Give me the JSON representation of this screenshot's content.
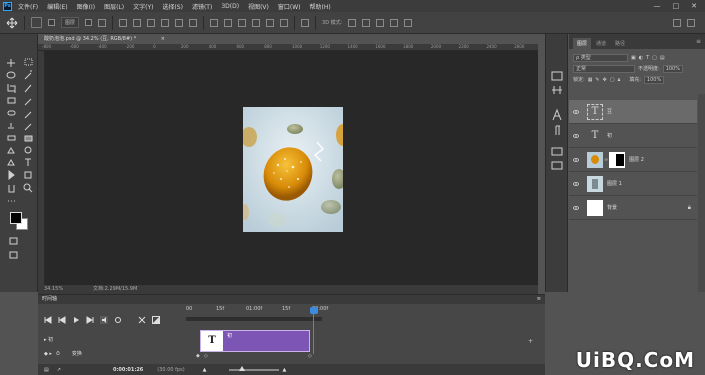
{
  "app": {
    "logo_text": "Ps"
  },
  "menu": [
    "文件(F)",
    "编辑(E)",
    "图像(I)",
    "图层(L)",
    "文字(Y)",
    "选择(S)",
    "滤镜(T)",
    "3D(D)",
    "视图(V)",
    "窗口(W)",
    "帮助(H)"
  ],
  "window_controls": [
    "—",
    "□",
    "✕"
  ],
  "options": {
    "auto_select_value": "图层",
    "mode_3d": "3D 模式:"
  },
  "document": {
    "tab_title": "酸奶泡泡.psd @ 34.2% (豆, RGB/8#) *",
    "zoom": "34.15%",
    "info": "文档:2.29M/15.9M"
  },
  "ruler": {
    "top_marks": [
      "-800",
      "-600",
      "-400",
      "-200",
      "0",
      "200",
      "400",
      "600",
      "800",
      "1000",
      "1200",
      "1400",
      "1600",
      "1800",
      "2000",
      "2200",
      "2400",
      "2600"
    ]
  },
  "layers_panel": {
    "tabs": [
      "图层",
      "通道",
      "路径"
    ],
    "filter_label": "ρ 类型",
    "blend_mode": "正常",
    "opacity_label": "不透明度:",
    "opacity_value": "100%",
    "lock_label": "锁定:",
    "fill_label": "填充:",
    "fill_value": "100%",
    "layers": [
      {
        "name": "豆",
        "kind": "text",
        "selected": true
      },
      {
        "name": "初",
        "kind": "text",
        "selected": false
      },
      {
        "name": "图层 2",
        "kind": "masked",
        "selected": false
      },
      {
        "name": "图层 1",
        "kind": "image",
        "selected": false
      },
      {
        "name": "背景",
        "kind": "background",
        "selected": false
      }
    ]
  },
  "timeline": {
    "title": "时间轴",
    "ruler_marks": [
      "00",
      "15f",
      "01:00f",
      "15f",
      "02:00f"
    ],
    "track_name": "初",
    "track_sub": "变换",
    "clip_label": "初",
    "current_time": "0:00:01:26",
    "fps": "(30.00 fps)"
  },
  "watermark": "UiBQ.CoM",
  "colors": {
    "accent": "#3b8be0",
    "clip": "#7d55b4",
    "canvas_bg": "#282828"
  }
}
